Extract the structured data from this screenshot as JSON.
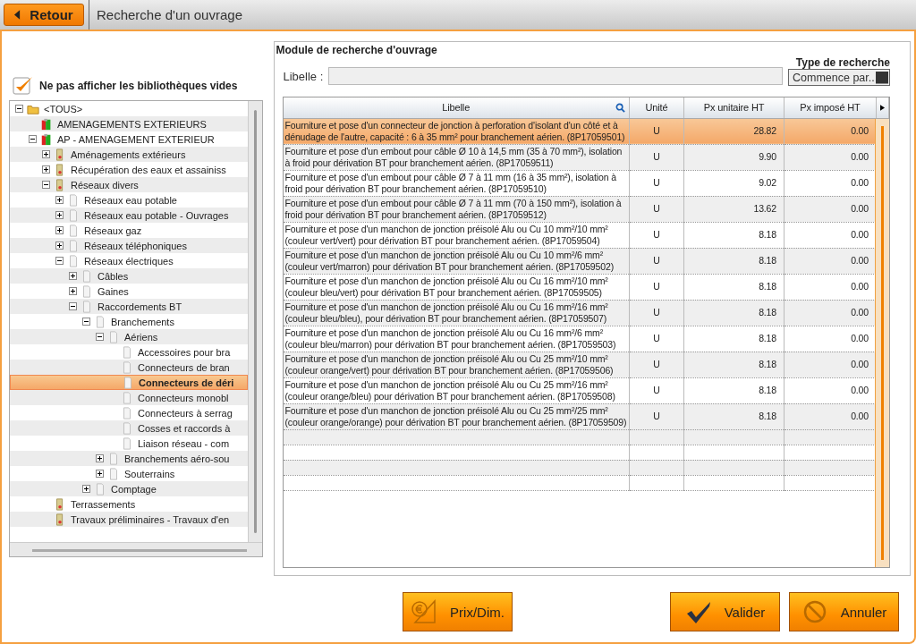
{
  "header": {
    "back_button": "Retour",
    "title": "Recherche d'un ouvrage"
  },
  "filter": {
    "label": "Ne pas afficher les bibliothèques vides",
    "checked": true
  },
  "tree": [
    {
      "label": "<TOUS>",
      "kind": "folder",
      "expanded": true,
      "selected": false,
      "children": [
        {
          "label": "AMENAGEMENTS EXTERIEURS",
          "kind": "library",
          "selected": false
        },
        {
          "label": "AP - AMENAGEMENT EXTERIEUR",
          "kind": "library",
          "expanded": true,
          "selected": false,
          "children": [
            {
              "label": "Aménagements extérieurs",
              "kind": "chapter",
              "expanded": false,
              "selected": false
            },
            {
              "label": "Récupération des eaux et assainiss",
              "kind": "chapter",
              "expanded": false,
              "selected": false
            },
            {
              "label": "Réseaux divers",
              "kind": "chapter",
              "expanded": true,
              "selected": false,
              "children": [
                {
                  "label": "Réseaux eau potable",
                  "kind": "page",
                  "expanded": false,
                  "selected": false
                },
                {
                  "label": "Réseaux eau potable - Ouvrages",
                  "kind": "page",
                  "expanded": false,
                  "selected": false
                },
                {
                  "label": "Réseaux gaz",
                  "kind": "page",
                  "expanded": false,
                  "selected": false
                },
                {
                  "label": "Réseaux téléphoniques",
                  "kind": "page",
                  "expanded": false,
                  "selected": false
                },
                {
                  "label": "Réseaux électriques",
                  "kind": "page",
                  "expanded": true,
                  "selected": false,
                  "children": [
                    {
                      "label": "Câbles",
                      "kind": "page",
                      "expanded": false,
                      "selected": false
                    },
                    {
                      "label": "Gaines",
                      "kind": "page",
                      "expanded": false,
                      "selected": false
                    },
                    {
                      "label": "Raccordements BT",
                      "kind": "page",
                      "expanded": true,
                      "selected": false,
                      "children": [
                        {
                          "label": "Branchements",
                          "kind": "page",
                          "expanded": true,
                          "selected": false,
                          "children": [
                            {
                              "label": "Aériens",
                              "kind": "page",
                              "expanded": true,
                              "selected": false,
                              "children": [
                                {
                                  "label": "Accessoires pour bra",
                                  "kind": "page",
                                  "selected": false
                                },
                                {
                                  "label": "Connecteurs de bran",
                                  "kind": "page",
                                  "selected": false
                                },
                                {
                                  "label": "Connecteurs de déri",
                                  "kind": "page",
                                  "selected": true
                                },
                                {
                                  "label": "Connecteurs monobl",
                                  "kind": "page",
                                  "selected": false
                                },
                                {
                                  "label": "Connecteurs à serrag",
                                  "kind": "page",
                                  "selected": false
                                },
                                {
                                  "label": "Cosses et raccords à",
                                  "kind": "page",
                                  "selected": false
                                },
                                {
                                  "label": "Liaison réseau - com",
                                  "kind": "page",
                                  "selected": false
                                }
                              ]
                            },
                            {
                              "label": "Branchements aéro-sou",
                              "kind": "page",
                              "expanded": false,
                              "selected": false
                            },
                            {
                              "label": "Souterrains",
                              "kind": "page",
                              "expanded": false,
                              "selected": false
                            }
                          ]
                        },
                        {
                          "label": "Comptage",
                          "kind": "page",
                          "expanded": false,
                          "selected": false
                        }
                      ]
                    }
                  ]
                }
              ]
            },
            {
              "label": "Terrassements",
              "kind": "chapter",
              "selected": false
            },
            {
              "label": "Travaux préliminaires - Travaux d'en",
              "kind": "chapter",
              "selected": false
            }
          ]
        }
      ]
    }
  ],
  "search": {
    "title": "Module de recherche d'ouvrage",
    "label": "Libelle :",
    "type_label": "Type de recherche",
    "type_value": "Commence par.."
  },
  "table": {
    "columns": [
      "Libelle",
      "Unité",
      "Px unitaire HT",
      "Px imposé HT"
    ],
    "rows": [
      {
        "libelle": "Fourniture et pose d'un connecteur de jonction à perforation d'isolant d'un côté et à dénudage de l'autre, capacité : 6 à 35 mm² pour branchement aérien. (8P17059501)",
        "unite": "U",
        "px_unitaire": "28.82",
        "px_impose": "0.00",
        "selected": true
      },
      {
        "libelle": "Fourniture et pose d'un embout pour câble Ø 10 à 14,5 mm (35 à 70 mm²), isolation à froid pour dérivation BT pour branchement aérien. (8P17059511)",
        "unite": "U",
        "px_unitaire": "9.90",
        "px_impose": "0.00",
        "selected": false
      },
      {
        "libelle": "Fourniture et pose d'un embout pour câble Ø 7 à 11 mm (16 à 35 mm²), isolation à froid pour dérivation BT pour branchement aérien. (8P17059510)",
        "unite": "U",
        "px_unitaire": "9.02",
        "px_impose": "0.00",
        "selected": false
      },
      {
        "libelle": "Fourniture et pose d'un embout pour câble Ø 7 à 11 mm (70 à 150 mm²), isolation à froid pour dérivation BT pour branchement aérien. (8P17059512)",
        "unite": "U",
        "px_unitaire": "13.62",
        "px_impose": "0.00",
        "selected": false
      },
      {
        "libelle": "Fourniture et pose d'un manchon de jonction préisolé Alu ou Cu 10 mm²/10 mm² (couleur vert/vert) pour dérivation BT pour branchement aérien. (8P17059504)",
        "unite": "U",
        "px_unitaire": "8.18",
        "px_impose": "0.00",
        "selected": false
      },
      {
        "libelle": "Fourniture et pose d'un manchon de jonction préisolé Alu ou Cu 10 mm²/6 mm² (couleur vert/marron) pour dérivation BT pour branchement aérien. (8P17059502)",
        "unite": "U",
        "px_unitaire": "8.18",
        "px_impose": "0.00",
        "selected": false
      },
      {
        "libelle": "Fourniture et pose d'un manchon de jonction préisolé Alu ou Cu 16 mm²/10 mm² (couleur bleu/vert) pour dérivation BT pour branchement aérien. (8P17059505)",
        "unite": "U",
        "px_unitaire": "8.18",
        "px_impose": "0.00",
        "selected": false
      },
      {
        "libelle": "Fourniture et pose d'un manchon de jonction préisolé Alu ou Cu 16 mm²/16 mm² (couleur bleu/bleu), pour dérivation BT pour branchement aérien. (8P17059507)",
        "unite": "U",
        "px_unitaire": "8.18",
        "px_impose": "0.00",
        "selected": false
      },
      {
        "libelle": "Fourniture et pose d'un manchon de jonction préisolé Alu ou Cu 16 mm²/6 mm² (couleur bleu/marron) pour dérivation BT pour branchement aérien. (8P17059503)",
        "unite": "U",
        "px_unitaire": "8.18",
        "px_impose": "0.00",
        "selected": false
      },
      {
        "libelle": "Fourniture et pose d'un manchon de jonction préisolé Alu ou Cu 25 mm²/10 mm² (couleur orange/vert) pour dérivation BT pour branchement aérien. (8P17059506)",
        "unite": "U",
        "px_unitaire": "8.18",
        "px_impose": "0.00",
        "selected": false
      },
      {
        "libelle": "Fourniture et pose d'un manchon de jonction préisolé Alu ou Cu 25 mm²/16 mm² (couleur orange/bleu) pour dérivation BT pour branchement aérien. (8P17059508)",
        "unite": "U",
        "px_unitaire": "8.18",
        "px_impose": "0.00",
        "selected": false
      },
      {
        "libelle": "Fourniture et pose d'un manchon de jonction préisolé Alu ou Cu 25 mm²/25 mm² (couleur orange/orange) pour dérivation BT pour branchement aérien. (8P17059509)",
        "unite": "U",
        "px_unitaire": "8.18",
        "px_impose": "0.00",
        "selected": false
      }
    ]
  },
  "buttons": [
    {
      "label": "Prix/Dim.",
      "kind": "price"
    },
    {
      "label": "Valider",
      "kind": "ok"
    },
    {
      "label": "Annuler",
      "kind": "cancel"
    }
  ]
}
